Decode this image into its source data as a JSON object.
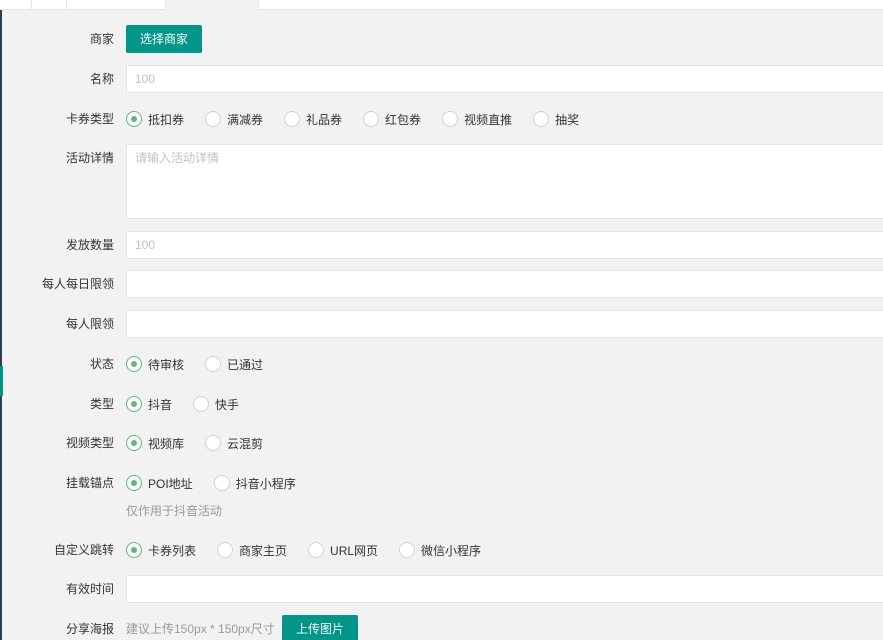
{
  "form": {
    "merchant": {
      "label": "商家",
      "button": "选择商家"
    },
    "name": {
      "label": "名称",
      "placeholder": "100"
    },
    "card_type": {
      "label": "卡券类型",
      "options": [
        "抵扣券",
        "满减券",
        "礼品券",
        "红包券",
        "视频直推",
        "抽奖"
      ],
      "selected": "抵扣券"
    },
    "activity_detail": {
      "label": "活动详情",
      "placeholder": "请输入活动详情"
    },
    "issue_qty": {
      "label": "发放数量",
      "placeholder": "100"
    },
    "daily_limit": {
      "label": "每人每日限领",
      "value": ""
    },
    "per_person_limit": {
      "label": "每人限领",
      "value": ""
    },
    "status": {
      "label": "状态",
      "options": [
        "待审核",
        "已通过"
      ],
      "selected": "待审核"
    },
    "type": {
      "label": "类型",
      "options": [
        "抖音",
        "快手"
      ],
      "selected": "抖音"
    },
    "video_type": {
      "label": "视频类型",
      "options": [
        "视频库",
        "云混剪"
      ],
      "selected": "视频库"
    },
    "anchor": {
      "label": "挂载锚点",
      "options": [
        "POI地址",
        "抖音小程序"
      ],
      "selected": "POI地址",
      "hint": "仅作用于抖音活动"
    },
    "custom_jump": {
      "label": "自定义跳转",
      "options": [
        "卡券列表",
        "商家主页",
        "URL网页",
        "微信小程序"
      ],
      "selected": "卡券列表"
    },
    "valid_time": {
      "label": "有效时间",
      "value": ""
    },
    "share_poster": {
      "label": "分享海报",
      "hint": "建议上传150px * 150px尺寸",
      "button": "上传图片"
    }
  },
  "colors": {
    "primary": "#009688",
    "radio_on": "#5fb878",
    "bg": "#f2f2f2"
  }
}
